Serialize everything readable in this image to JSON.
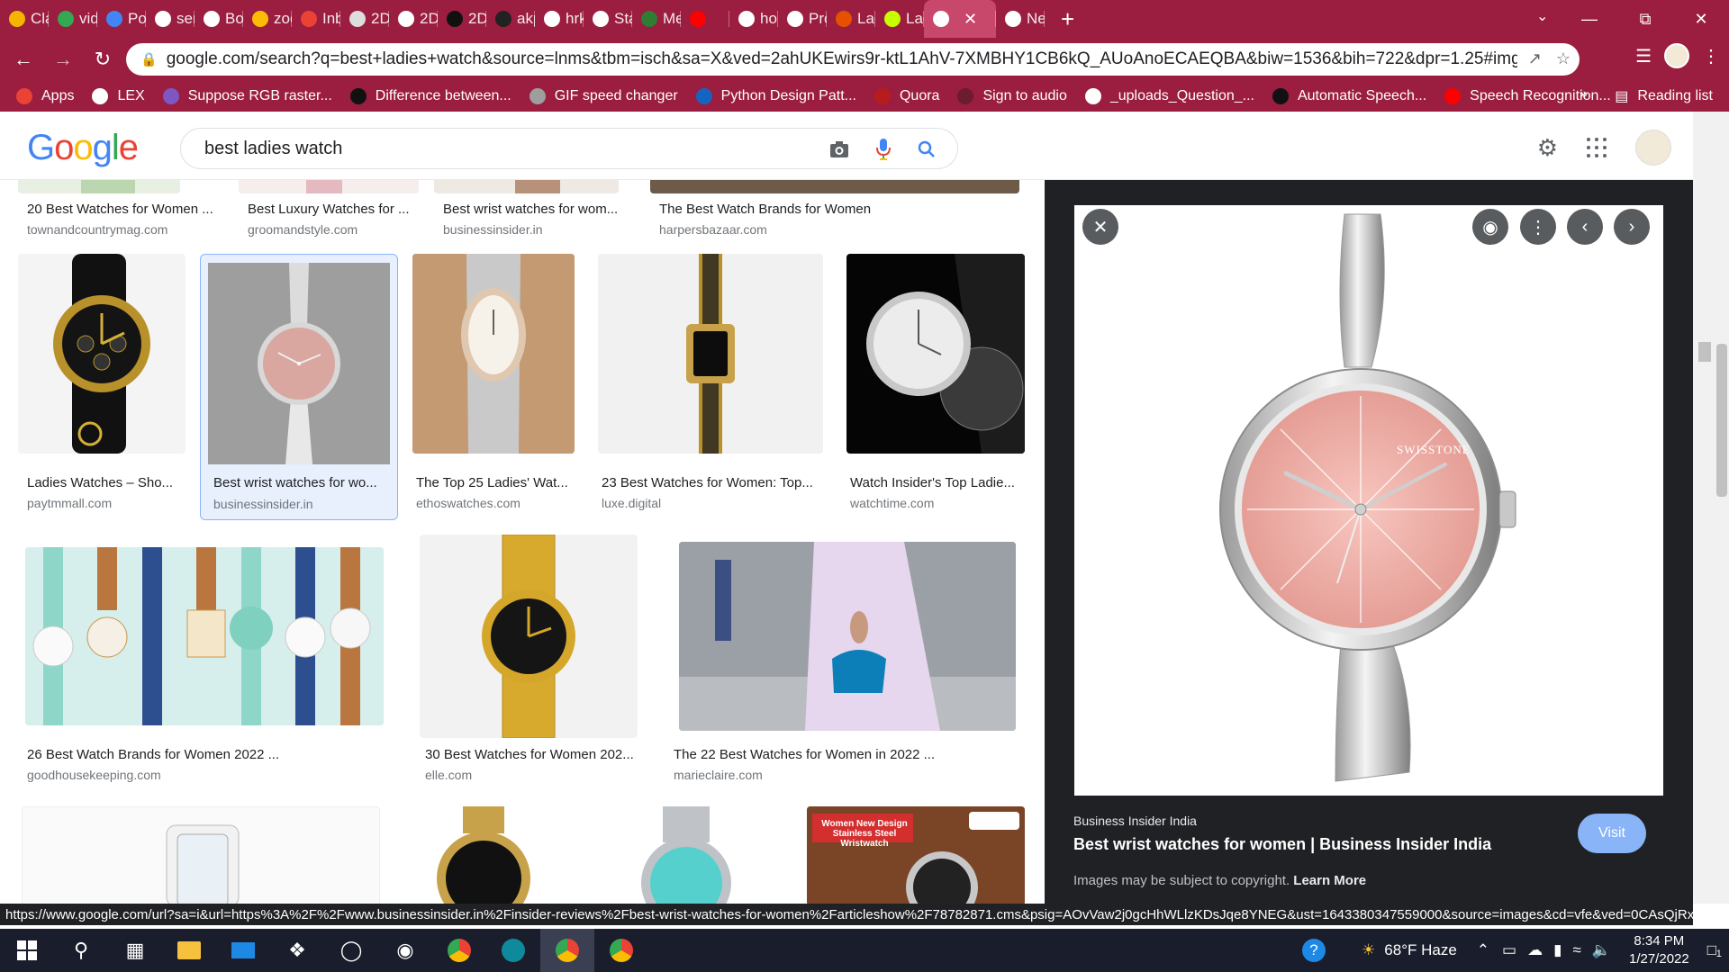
{
  "browser": {
    "tabs": [
      {
        "label": "Clas",
        "color": "#f4b400"
      },
      {
        "label": "vide",
        "color": "#34a853"
      },
      {
        "label": "Post",
        "color": "#4285f4"
      },
      {
        "label": "sem",
        "color": "#ffffff"
      },
      {
        "label": "Bot",
        "color": "#ffffff"
      },
      {
        "label": "zoo",
        "color": "#fbbc05"
      },
      {
        "label": "Inb",
        "color": "#ea4335"
      },
      {
        "label": "2D",
        "color": "#dddddd"
      },
      {
        "label": "2D",
        "color": "#ffffff"
      },
      {
        "label": "2D",
        "color": "#111111"
      },
      {
        "label": "akp",
        "color": "#222222"
      },
      {
        "label": "hrk",
        "color": "#ffffff"
      },
      {
        "label": "Star",
        "color": "#ffffff"
      },
      {
        "label": "Mer",
        "color": "#2e7d32"
      },
      {
        "label": "",
        "color": "#ff0000"
      },
      {
        "label": "hon",
        "color": "#ffffff"
      },
      {
        "label": "Pro",
        "color": "#ffffff"
      },
      {
        "label": "Lad",
        "color": "#e65100"
      },
      {
        "label": "Lad",
        "color": "#c6ff00"
      },
      {
        "label": "",
        "color": "#ffffff",
        "active": true
      },
      {
        "label": "Nev",
        "color": "#ffffff"
      }
    ],
    "url": "google.com/search?q=best+ladies+watch&source=lnms&tbm=isch&sa=X&ved=2ahUKEwirs9r-ktL1AhV-7XMBHY1CB6kQ_AUoAnoECAEQBA&biw=1536&bih=722&dpr=1.25#imgrc=0DjS8SlOy-v...",
    "bookmarks": [
      {
        "label": "Apps",
        "color": "#ea4335"
      },
      {
        "label": "LEX",
        "color": "#ffffff"
      },
      {
        "label": "Suppose RGB raster...",
        "color": "#7e57c2"
      },
      {
        "label": "Difference between...",
        "color": "#111111"
      },
      {
        "label": "GIF speed changer",
        "color": "#9e9e9e"
      },
      {
        "label": "Python Design Patt...",
        "color": "#1565c0"
      },
      {
        "label": "Quora",
        "color": "#b71c1c"
      },
      {
        "label": "Sign to audio",
        "color": "#6d1b2f"
      },
      {
        "label": "_uploads_Question_...",
        "color": "#ffffff"
      },
      {
        "label": "Automatic Speech...",
        "color": "#111111"
      },
      {
        "label": "Speech Recognition...",
        "color": "#ff0000"
      }
    ],
    "reading_list": "Reading list"
  },
  "google": {
    "logo": [
      "G",
      "o",
      "o",
      "g",
      "l",
      "e"
    ],
    "query": "best ladies watch"
  },
  "results": {
    "row0": [
      {
        "title": "20 Best Watches for Women ...",
        "src": "townandcountrymag.com"
      },
      {
        "title": "Best Luxury Watches for ...",
        "src": "groomandstyle.com"
      },
      {
        "title": "Best wrist watches for wom...",
        "src": "businessinsider.in"
      },
      {
        "title": "The Best Watch Brands for Women",
        "src": "harpersbazaar.com"
      }
    ],
    "row1": [
      {
        "title": "Ladies Watches – Sho...",
        "src": "paytmmall.com"
      },
      {
        "title": "Best wrist watches for wo...",
        "src": "businessinsider.in"
      },
      {
        "title": "The Top 25 Ladies' Wat...",
        "src": "ethoswatches.com"
      },
      {
        "title": "23 Best Watches for Women: Top...",
        "src": "luxe.digital"
      },
      {
        "title": "Watch Insider's Top Ladie...",
        "src": "watchtime.com"
      }
    ],
    "row2": [
      {
        "title": "26 Best Watch Brands for Women 2022 ...",
        "src": "goodhousekeeping.com"
      },
      {
        "title": "30 Best Watches for Women 202...",
        "src": "elle.com"
      },
      {
        "title": "The 22 Best Watches for Women in 2022 ...",
        "src": "marieclaire.com"
      }
    ],
    "row3_banner": "Women New Design Stainless Steel Wristwatch"
  },
  "panel": {
    "watch_brand": "SWISSTONE",
    "source": "Business Insider India",
    "title": "Best wrist watches for women | Business Insider India",
    "visit": "Visit",
    "copyright": "Images may be subject to copyright.",
    "learn_more": "Learn More"
  },
  "status_url": "https://www.google.com/url?sa=i&url=https%3A%2F%2Fwww.businessinsider.in%2Finsider-reviews%2Fbest-wrist-watches-for-women%2Farticleshow%2F78782871.cms&psig=AOvVaw2j0gcHhWLlzKDsJqe8YNEG&ust=1643380347559000&source=images&cd=vfe&ved=0CAsQjRxq...",
  "taskbar": {
    "weather": "68°F Haze",
    "time": "8:34 PM",
    "date": "1/27/2022",
    "notifications": "1"
  }
}
